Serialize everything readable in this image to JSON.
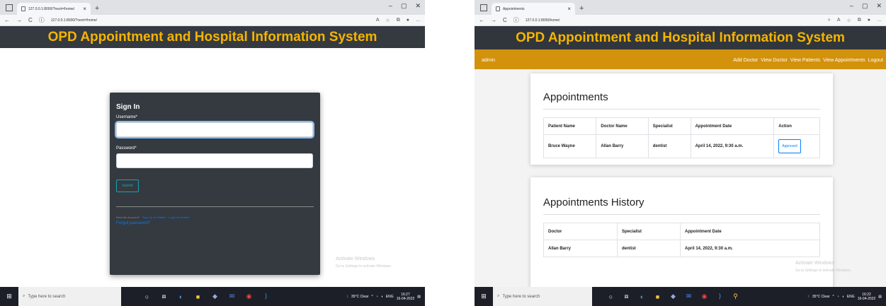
{
  "left": {
    "tab_title": "127.0.0.1:8000/?next=/home/",
    "url": "127.0.0.1:8000/?next=/home/",
    "header_title": "OPD Appointment and Hospital Information System",
    "form_title": "Sign In",
    "username_label": "Username*",
    "password_label": "Password*",
    "submit_label": "Submit",
    "need_account": "Need An Account?",
    "signup_patient": "Sign Up As Patient",
    "login_patient": "Login As Patient",
    "forgot": "Forgot password?",
    "activate_title": "Activate Windows",
    "activate_sub": "Go to Settings to activate Windows.",
    "search_placeholder": "Type here to search",
    "tray_weather": "35°C Clear",
    "tray_lang": "ENG",
    "clock_time": "16:27",
    "clock_date": "16-04-2022"
  },
  "right": {
    "tab_title": "Appointments",
    "url": "127.0.0.1:8000/home/",
    "header_title": "OPD Appointment and Hospital Information System",
    "nav_user": "admin",
    "nav_links": [
      "Add Doctor",
      "View Doctor",
      "View Patients",
      "View Appointments",
      "Logout"
    ],
    "appointments_title": "Appointments",
    "appt_headers": [
      "Patient Name",
      "Doctor Name",
      "Specialist",
      "Appointment Date",
      "Action"
    ],
    "appt_row": [
      "Bruce Wayne",
      "Allan Barry",
      "dentist",
      "April 14, 2022, 9:30 a.m."
    ],
    "approved_label": "Approved",
    "history_title": "Appointments History",
    "hist_headers": [
      "Doctor",
      "Specialist",
      "Appointment Date"
    ],
    "hist_row": [
      "Allan Barry",
      "dentist",
      "April 14, 2022, 9:30 a.m."
    ],
    "activate_title": "Activate Windows",
    "activate_sub": "Go to Settings to activate Windows.",
    "search_placeholder": "Type here to search",
    "tray_weather": "35°C Clear",
    "tray_lang": "ENG",
    "clock_time": "16:22",
    "clock_date": "16-04-2022"
  }
}
